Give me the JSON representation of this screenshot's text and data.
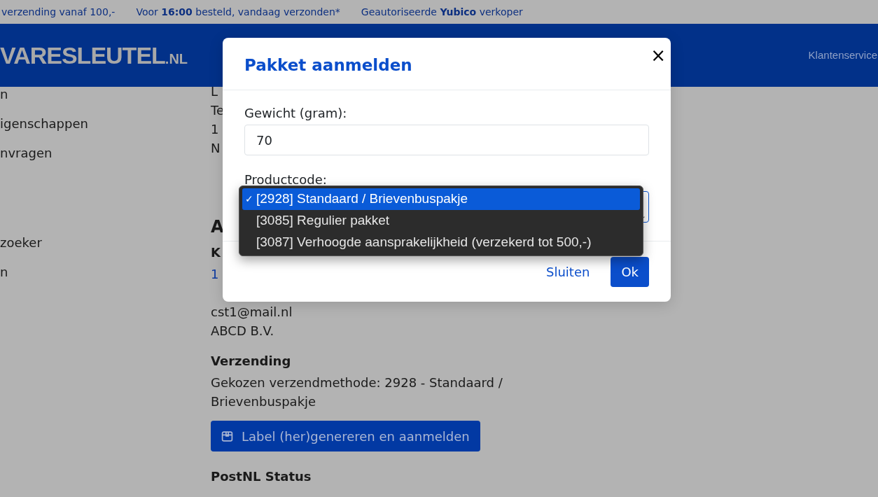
{
  "top_bar": {
    "items": [
      "verzending vanaf 100,-",
      "Voor **16:00** besteld, vandaag verzonden*",
      "Geautoriseerde **Yubico** verkoper"
    ]
  },
  "header": {
    "logo": {
      "text": "VARESLEUTEL",
      "suffix": ".NL"
    },
    "nav": [
      "Klantenservice"
    ]
  },
  "sidebar": {
    "groups": [
      {
        "items": [
          "n",
          "igenschappen",
          "nvragen"
        ]
      },
      {
        "items": [
          "zoeker",
          "n"
        ]
      }
    ]
  },
  "main": {
    "address_lines": [
      "L",
      "Te",
      "1",
      "N"
    ],
    "heading": "A",
    "customer": {
      "label": "K",
      "id": "1",
      "email": "cst1@mail.nl",
      "company": "ABCD B.V."
    },
    "shipping": {
      "title": "Verzending",
      "text": "Gekozen verzendmethode: 2928 - Standaard / Brievenbuspakje",
      "button": "Label (her)genereren en aanmelden"
    },
    "status_title": "PostNL Status"
  },
  "modal": {
    "title": "Pakket aanmelden",
    "close": "×",
    "fields": [
      {
        "kind": "input",
        "label": "Gewicht (gram):",
        "value": "70"
      },
      {
        "kind": "select",
        "label": "Productcode:",
        "open": true,
        "caret": "⌄",
        "check": "✓",
        "options": [
          {
            "label": "[2928] Standaard / Brievenbuspakje",
            "selected": true
          },
          {
            "label": "[3085] Regulier pakket",
            "selected": false
          },
          {
            "label": "[3087] Verhoogde aansprakelijkheid (verzekerd tot 500,-)",
            "selected": false
          }
        ]
      }
    ],
    "buttons": [
      {
        "kind": "link",
        "label": "Sluiten"
      },
      {
        "kind": "primary",
        "label": "Ok"
      }
    ]
  }
}
